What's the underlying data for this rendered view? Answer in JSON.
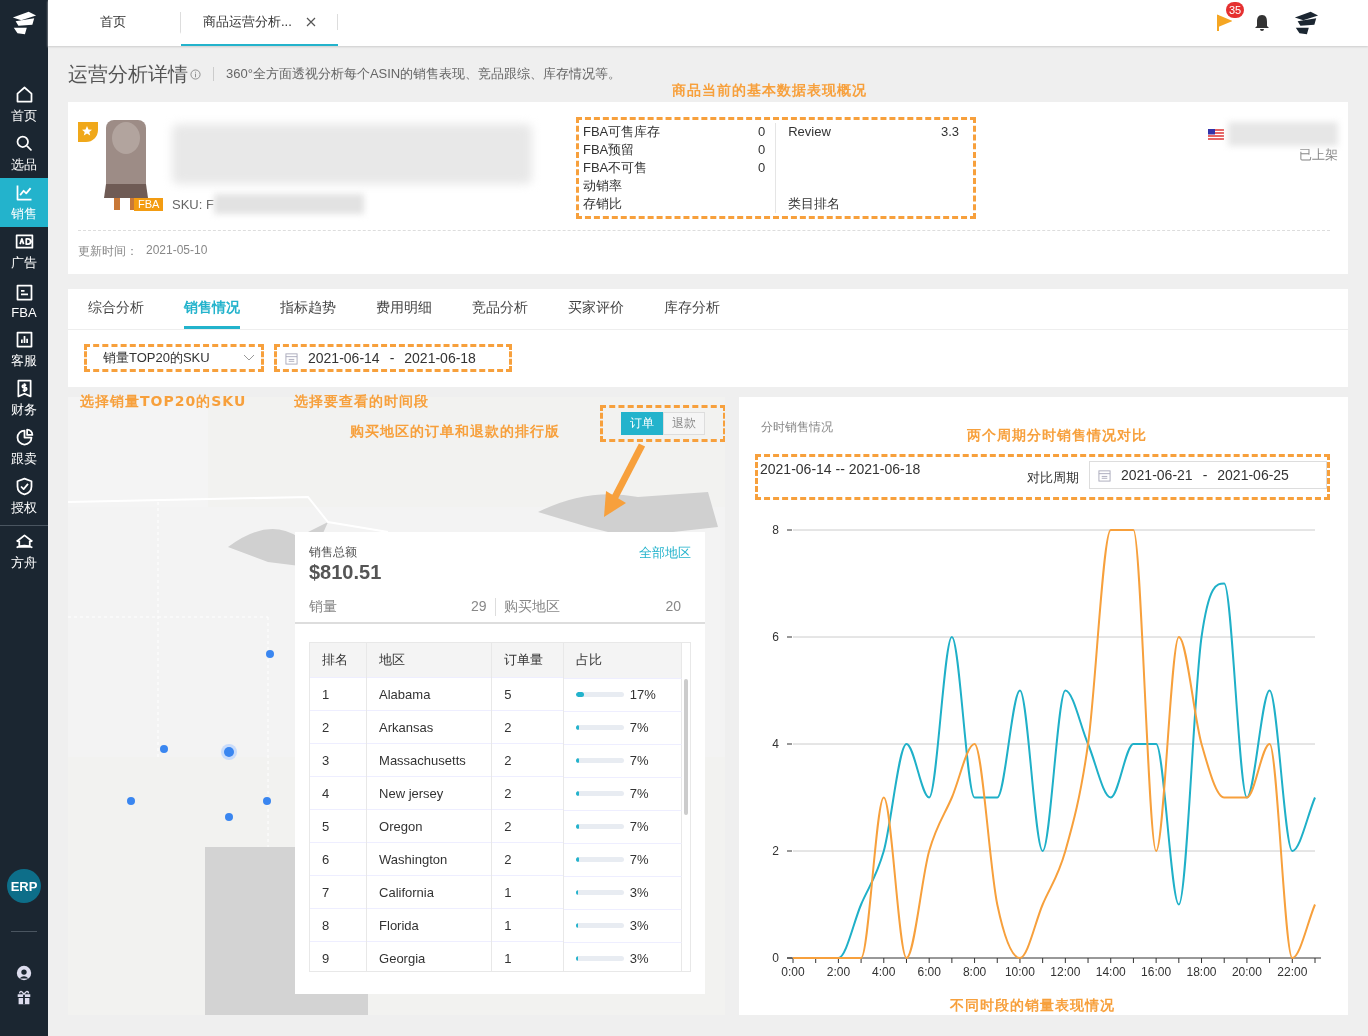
{
  "sidebar": {
    "items": [
      {
        "label": "首页",
        "selected": false
      },
      {
        "label": "选品",
        "selected": false
      },
      {
        "label": "销售",
        "selected": true
      },
      {
        "label": "广告",
        "selected": false
      },
      {
        "label": "FBA",
        "selected": false
      },
      {
        "label": "客服",
        "selected": false
      },
      {
        "label": "财务",
        "selected": false
      },
      {
        "label": "跟卖",
        "selected": false
      },
      {
        "label": "授权",
        "selected": false
      },
      {
        "label": "方舟",
        "selected": false
      }
    ],
    "erp": "ERP"
  },
  "tabs": [
    {
      "label": "首页",
      "selected": false,
      "closable": false
    },
    {
      "label": "商品运营分析...",
      "selected": true,
      "closable": true
    }
  ],
  "header": {
    "notification_count": "35"
  },
  "page": {
    "title": "运营分析详情",
    "description": "360°全方面透视分析每个ASIN的销售表现、竞品跟综、库存情况等。"
  },
  "product": {
    "annotation": "商品当前的基本数据表现概况",
    "fulfillment": "FBA",
    "sku_label": "SKU: F",
    "metrics": [
      {
        "label": "FBA可售库存",
        "value": "0"
      },
      {
        "label": "FBA预留",
        "value": "0"
      },
      {
        "label": "FBA不可售",
        "value": "0"
      },
      {
        "label": "动销率"
      },
      {
        "label": "存销比"
      }
    ],
    "review": {
      "label": "Review",
      "value": "3.3"
    },
    "category_rank": "类目排名",
    "status": "已上架",
    "updated": {
      "label": "更新时间：",
      "value": "2021-05-10"
    }
  },
  "section_tabs": [
    {
      "label": "综合分析",
      "selected": false
    },
    {
      "label": "销售情况",
      "selected": true
    },
    {
      "label": "指标趋势",
      "selected": false
    },
    {
      "label": "费用明细",
      "selected": false
    },
    {
      "label": "竞品分析",
      "selected": false
    },
    {
      "label": "买家评价",
      "selected": false
    },
    {
      "label": "库存分析",
      "selected": false
    }
  ],
  "filters": {
    "sku_select": "销量TOP20的SKU",
    "date_from": "2021-06-14",
    "date_separator": "-",
    "date_to": "2021-06-18",
    "sku_annotation": "选择销量TOP20的SKU",
    "date_annotation": "选择要查看的时间段"
  },
  "map_panel": {
    "annotation": "购买地区的订单和退款的排行版",
    "toggle": [
      {
        "label": "订单",
        "selected": true
      },
      {
        "label": "退款",
        "selected": false
      }
    ],
    "total_label": "销售总额",
    "total": "$810.51",
    "all_regions": "全部地区",
    "qty_label": "销量",
    "qty": "29",
    "regions_label": "购买地区",
    "regions": "20",
    "table": {
      "columns": [
        "排名",
        "地区",
        "订单量",
        "占比"
      ],
      "rows": [
        {
          "rank": "1",
          "region": "Alabama",
          "orders": "5",
          "level": 0.17,
          "share": "17%"
        },
        {
          "rank": "2",
          "region": "Arkansas",
          "orders": "2",
          "level": 0.07,
          "share": "7%"
        },
        {
          "rank": "3",
          "region": "Massachusetts",
          "orders": "2",
          "level": 0.07,
          "share": "7%"
        },
        {
          "rank": "4",
          "region": "New jersey",
          "orders": "2",
          "level": 0.07,
          "share": "7%"
        },
        {
          "rank": "5",
          "region": "Oregon",
          "orders": "2",
          "level": 0.07,
          "share": "7%"
        },
        {
          "rank": "6",
          "region": "Washington",
          "orders": "2",
          "level": 0.07,
          "share": "7%"
        },
        {
          "rank": "7",
          "region": "California",
          "orders": "1",
          "level": 0.03,
          "share": "3%"
        },
        {
          "rank": "8",
          "region": "Florida",
          "orders": "1",
          "level": 0.03,
          "share": "3%"
        },
        {
          "rank": "9",
          "region": "Georgia",
          "orders": "1",
          "level": 0.03,
          "share": "3%"
        }
      ]
    }
  },
  "hourly": {
    "title": "分时销售情况",
    "annotation": "两个周期分时销售情况对比",
    "period": "2021-06-14 -- 2021-06-18",
    "compare_label": "对比周期",
    "compare_from": "2021-06-21",
    "compare_separator": "-",
    "compare_to": "2021-06-25",
    "caption": "不同时段的销量表现情况",
    "chart_data": {
      "type": "line",
      "x": [
        0,
        1,
        2,
        3,
        4,
        5,
        6,
        7,
        8,
        9,
        10,
        11,
        12,
        13,
        14,
        15,
        16,
        17,
        18,
        19,
        20,
        21,
        22,
        23
      ],
      "series": [
        {
          "color": "#1fb0c8",
          "values": [
            0,
            0,
            0,
            1,
            2,
            4,
            3,
            6,
            3,
            3,
            5,
            2,
            5,
            4,
            3,
            4,
            4,
            1,
            6,
            7,
            3,
            5,
            2,
            3
          ]
        },
        {
          "color": "#f7a03c",
          "values": [
            0,
            0,
            0,
            0,
            3,
            0,
            2,
            3,
            4,
            1,
            0,
            1,
            2,
            4,
            8,
            8,
            2,
            6,
            4,
            3,
            3,
            4,
            0,
            1
          ]
        }
      ],
      "xlim": [
        0,
        23
      ],
      "grid": true,
      "ylim": [
        0,
        8
      ],
      "yticks": [
        0,
        2,
        4,
        6,
        8
      ],
      "xticks": [
        {
          "value": 0,
          "label": "0:00"
        },
        {
          "value": 2,
          "label": "2:00"
        },
        {
          "value": 4,
          "label": "4:00"
        },
        {
          "value": 6,
          "label": "6:00"
        },
        {
          "value": 8,
          "label": "8:00"
        },
        {
          "value": 10,
          "label": "10:00"
        },
        {
          "value": 12,
          "label": "12:00"
        },
        {
          "value": 14,
          "label": "14:00"
        },
        {
          "value": 16,
          "label": "16:00"
        },
        {
          "value": 18,
          "label": "18:00"
        },
        {
          "value": 20,
          "label": "20:00"
        },
        {
          "value": 22,
          "label": "22:00"
        }
      ]
    }
  }
}
